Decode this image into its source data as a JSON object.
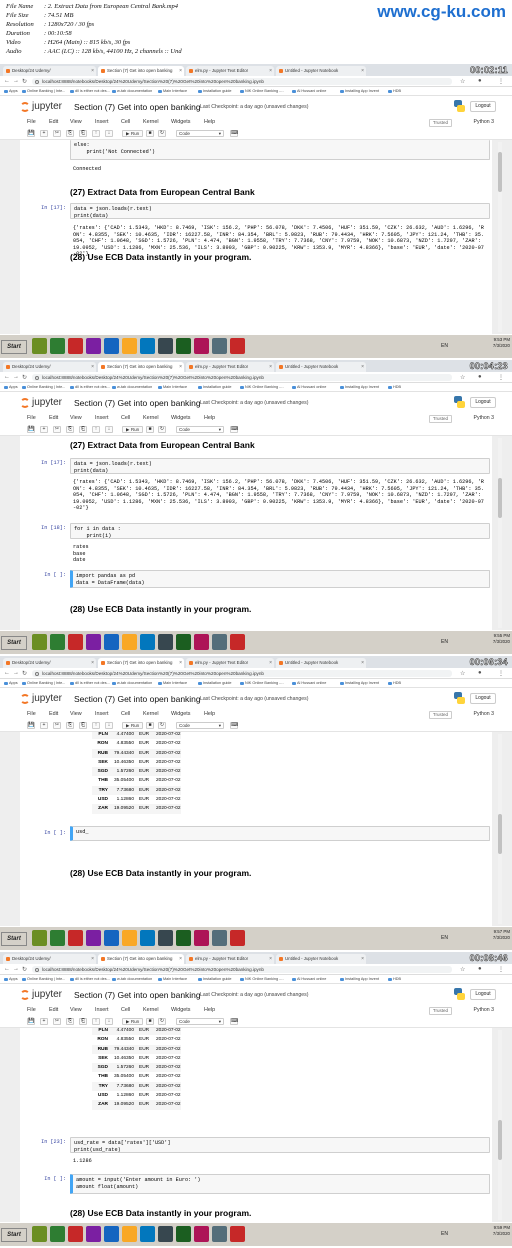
{
  "file_info": {
    "rows": [
      {
        "label": "File Name",
        "value": ":  2. Extract Data from European Central Bank.mp4"
      },
      {
        "label": "File Size",
        "value": ":  74.51 MB"
      },
      {
        "label": "Resolution",
        "value": ":  1280x720 / 30 fps"
      },
      {
        "label": "Duration",
        "value": ":  00:10:58"
      },
      {
        "label": "Video",
        "value": ":  H264 (Main) :: 815 kb/s, 30 fps"
      },
      {
        "label": "Audio",
        "value": ":  AAC (LC) :: 128 kb/s, 44100 Hz, 2 channels :: Und"
      }
    ],
    "watermark": "www.cg-ku.com"
  },
  "browser": {
    "tabs": [
      "Desktop/24 Udemy/",
      "Section (7) Get into open banking",
      "elm.py - Jupyter Text Editor",
      "Untitled - Jupyter Notebook"
    ],
    "url": "localhost:8888/notebooks/Desktop/24%20Udemy/Section%20(7)%20Get%20into%20open%20banking.ipynb",
    "bookmarks": [
      "Apps",
      "Online Banking | Inte...",
      "dll is either not des...",
      "w-tab documentation",
      "Main Interface",
      "Installation guide",
      "NIK Online Banking -...",
      "Al Hussani online",
      "Installing App Invent",
      "HDB"
    ]
  },
  "jupyter": {
    "logo_text": "jupyter",
    "notebook_title": "Section (7) Get into open banking",
    "checkpoint": "Last Checkpoint: a day ago  (unsaved changes)",
    "logout_label": "Logout",
    "menu": [
      "File",
      "Edit",
      "View",
      "Insert",
      "Cell",
      "Kernel",
      "Widgets",
      "Help"
    ],
    "trusted_label": "Trusted",
    "kernel_label": "Python 3",
    "run_label": "Run",
    "cell_type": "Code"
  },
  "taskbar": {
    "start_label": "Start",
    "lang": "EN"
  },
  "frames": [
    {
      "timestamp": "00:02:11",
      "tray_time": "9:53 PM",
      "tray_date": "7/3/2020",
      "code_else": "else:\n    print('Not Connected')",
      "out_connected": "Connected",
      "heading_27": "(27) Extract Data from European Central Bank",
      "prompt_17": "In [17]:",
      "code_17": "data = json.loads(r.text)\nprint(data)",
      "out_17": "{'rates': {'CAD': 1.5343, 'HKD': 8.7469, 'ISK': 156.2, 'PHP': 56.078, 'DKK': 7.4506, 'HUF': 351.59, 'CZK': 26.632, 'AUD': 1.6296, 'RON': 4.8355, 'SEK': 10.4635, 'IDR': 16227.58, 'INR': 84.354, 'BRL': 5.9823, 'RUB': 79.4434, 'HRK': 7.5605, 'JPY': 121.24, 'THB': 35.054, 'CHF': 1.0648, 'SGD': 1.5726, 'PLN': 4.474, 'BGN': 1.9558, 'TRY': 7.7368, 'CNY': 7.9759, 'NOK': 10.6873, 'NZD': 1.7297, 'ZAR': 19.0952, 'USD': 1.1286, 'MXN': 25.536, 'ILS': 3.8903, 'GBP': 0.90225, 'KRW': 1353.9, 'MYR': 4.8366}, 'base': 'EUR', 'date': '2020-07-02'}",
      "heading_28": "(28) Use ECB Data instantly in your program."
    },
    {
      "timestamp": "00:04:23",
      "tray_time": "9:55 PM",
      "tray_date": "7/3/2020",
      "heading_27": "(27) Extract Data from European Central Bank",
      "prompt_17": "In [17]:",
      "code_17": "data = json.loads(r.text)\nprint(data)",
      "out_17": "{'rates': {'CAD': 1.5343, 'HKD': 8.7469, 'ISK': 156.2, 'PHP': 56.078, 'DKK': 7.4506, 'HUF': 351.59, 'CZK': 26.632, 'AUD': 1.6296, 'RON': 4.8355, 'SEK': 10.4635, 'IDR': 16227.58, 'INR': 84.354, 'BRL': 5.9823, 'RUB': 79.4434, 'HRK': 7.5605, 'JPY': 121.24, 'THB': 35.054, 'CHF': 1.0648, 'SGD': 1.5726, 'PLN': 4.474, 'BGN': 1.9558, 'TRY': 7.7368, 'CNY': 7.9759, 'NOK': 10.6873, 'NZD': 1.7297, 'ZAR': 19.0952, 'USD': 1.1286, 'MXN': 25.536, 'ILS': 3.8903, 'GBP': 0.90225, 'KRW': 1353.9, 'MYR': 4.8366}, 'base': 'EUR', 'date': '2020-07-02'}",
      "prompt_18": "In [18]:",
      "code_18": "for i in data :\n    print(i)",
      "out_18": "rates\nbase\ndate",
      "prompt_empty": "In [ ]:",
      "code_new": "import pandas as pd\ndata = DataFrame(data)",
      "heading_28": "(28) Use ECB Data instantly in your program."
    },
    {
      "timestamp": "00:06:34",
      "tray_time": "9:57 PM",
      "tray_date": "7/3/2020",
      "prompt_empty": "In [ ]:",
      "code_new": "usd_",
      "heading_28": "(28) Use ECB Data instantly in your program."
    },
    {
      "timestamp": "00:08:46",
      "tray_time": "9:59 PM",
      "tray_date": "7/3/2020",
      "prompt_23": "In [23]:",
      "code_23": "usd_rate = data['rates']['USD']\nprint(usd_rate)",
      "out_23": "1.1286",
      "prompt_empty": "In [ ]:",
      "code_new": "amount = input('Enter amount in Euro: ')\namount float(amount)",
      "heading_28": "(28) Use ECB Data instantly in your program."
    }
  ],
  "dataframe_rows": [
    [
      "PLN",
      "4.47400",
      "EUR",
      "2020-07-02"
    ],
    [
      "RON",
      "4.83550",
      "EUR",
      "2020-07-02"
    ],
    [
      "RUB",
      "79.44340",
      "EUR",
      "2020-07-02"
    ],
    [
      "SEK",
      "10.46350",
      "EUR",
      "2020-07-02"
    ],
    [
      "SGD",
      "1.57260",
      "EUR",
      "2020-07-02"
    ],
    [
      "THB",
      "35.05400",
      "EUR",
      "2020-07-02"
    ],
    [
      "TRY",
      "7.73680",
      "EUR",
      "2020-07-02"
    ],
    [
      "USD",
      "1.12860",
      "EUR",
      "2020-07-02"
    ],
    [
      "ZAR",
      "19.09520",
      "EUR",
      "2020-07-02"
    ]
  ]
}
